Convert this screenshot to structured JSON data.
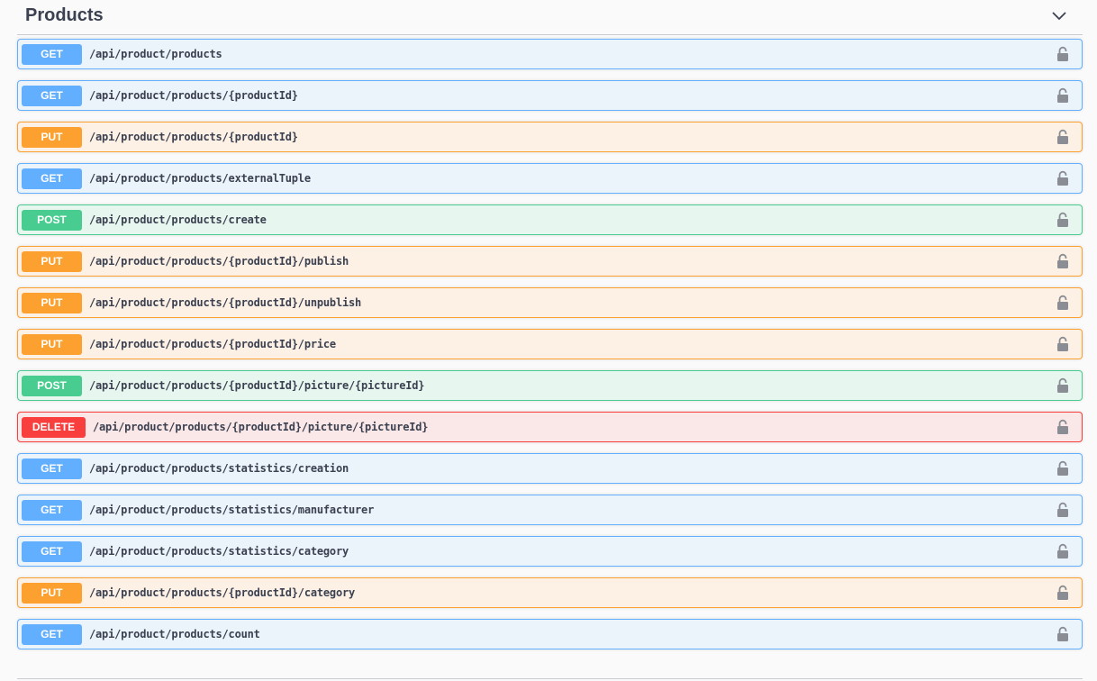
{
  "tag": {
    "title": "Products",
    "chevron_icon": "chevron-down-icon"
  },
  "method_colors": {
    "GET": "#61affe",
    "PUT": "#fca130",
    "POST": "#49cc90",
    "DELETE": "#f93e3e"
  },
  "lock_icon": "unlocked-padlock-icon",
  "operations": [
    {
      "method": "GET",
      "path": "/api/product/products"
    },
    {
      "method": "GET",
      "path": "/api/product/products/{productId}"
    },
    {
      "method": "PUT",
      "path": "/api/product/products/{productId}"
    },
    {
      "method": "GET",
      "path": "/api/product/products/externalTuple"
    },
    {
      "method": "POST",
      "path": "/api/product/products/create"
    },
    {
      "method": "PUT",
      "path": "/api/product/products/{productId}/publish"
    },
    {
      "method": "PUT",
      "path": "/api/product/products/{productId}/unpublish"
    },
    {
      "method": "PUT",
      "path": "/api/product/products/{productId}/price"
    },
    {
      "method": "POST",
      "path": "/api/product/products/{productId}/picture/{pictureId}"
    },
    {
      "method": "DELETE",
      "path": "/api/product/products/{productId}/picture/{pictureId}"
    },
    {
      "method": "GET",
      "path": "/api/product/products/statistics/creation"
    },
    {
      "method": "GET",
      "path": "/api/product/products/statistics/manufacturer"
    },
    {
      "method": "GET",
      "path": "/api/product/products/statistics/category"
    },
    {
      "method": "PUT",
      "path": "/api/product/products/{productId}/category"
    },
    {
      "method": "GET",
      "path": "/api/product/products/count"
    }
  ]
}
